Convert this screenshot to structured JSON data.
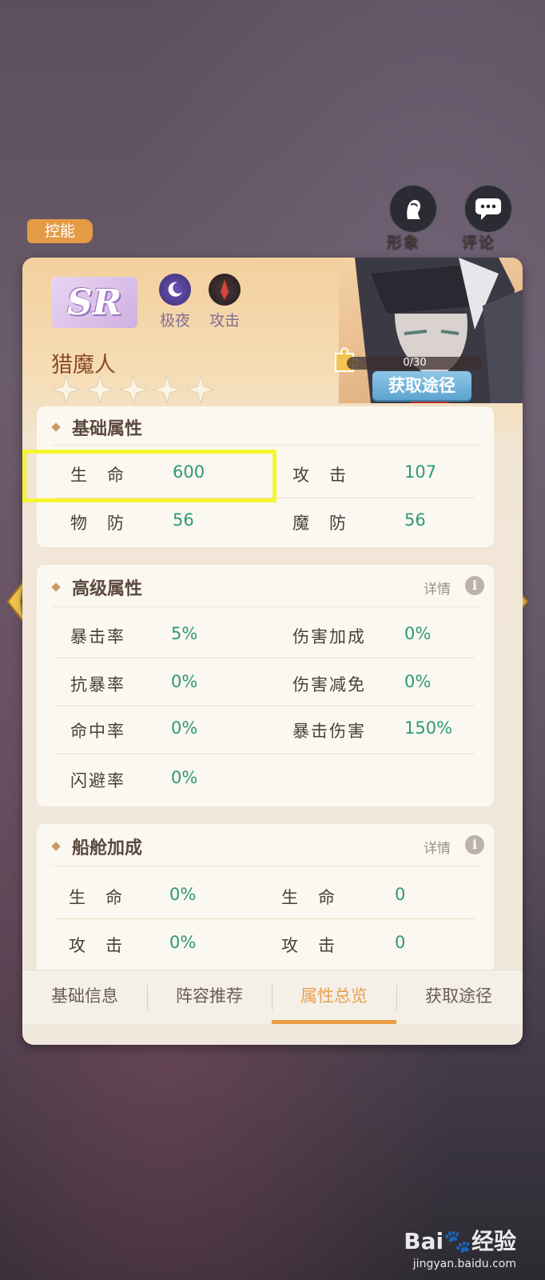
{
  "top_buttons": {
    "appearance_label": "形象",
    "comment_label": "评论"
  },
  "role_tag": "控能",
  "hero": {
    "rarity": "SR",
    "name": "猎魔人",
    "faction_label": "极夜",
    "class_label": "攻击",
    "stars_total": 5,
    "stars_filled": 0,
    "shard_progress": "0/30",
    "get_button_label": "获取途径"
  },
  "basic_attrs": {
    "title": "基础属性",
    "rows": [
      [
        {
          "label": "生　命",
          "value": "600"
        },
        {
          "label": "攻　击",
          "value": "107"
        }
      ],
      [
        {
          "label": "物　防",
          "value": "56"
        },
        {
          "label": "魔　防",
          "value": "56"
        }
      ]
    ]
  },
  "advanced_attrs": {
    "title": "高级属性",
    "detail_label": "详情",
    "rows": [
      [
        {
          "label": "暴击率",
          "value": "5%"
        },
        {
          "label": "伤害加成",
          "value": "0%"
        }
      ],
      [
        {
          "label": "抗暴率",
          "value": "0%"
        },
        {
          "label": "伤害减免",
          "value": "0%"
        }
      ],
      [
        {
          "label": "命中率",
          "value": "0%"
        },
        {
          "label": "暴击伤害",
          "value": "150%"
        }
      ],
      [
        {
          "label": "闪避率",
          "value": "0%"
        }
      ]
    ]
  },
  "cabin_bonus": {
    "title": "船舱加成",
    "detail_label": "详情",
    "rows": [
      [
        {
          "label": "生　命",
          "value": "0%"
        },
        {
          "label": "生　命",
          "value": "0"
        }
      ],
      [
        {
          "label": "攻　击",
          "value": "0%"
        },
        {
          "label": "攻　击",
          "value": "0"
        }
      ]
    ]
  },
  "tabs": [
    {
      "label": "基础信息",
      "active": false
    },
    {
      "label": "阵容推荐",
      "active": false
    },
    {
      "label": "属性总览",
      "active": true
    },
    {
      "label": "获取途径",
      "active": false
    }
  ],
  "watermark": {
    "brand": "Bai",
    "brand_suffix": "经验",
    "url": "jingyan.baidu.com"
  },
  "colors": {
    "accent": "#eb9d42",
    "value_green": "#2d9a73",
    "highlight": "#f6f630"
  }
}
